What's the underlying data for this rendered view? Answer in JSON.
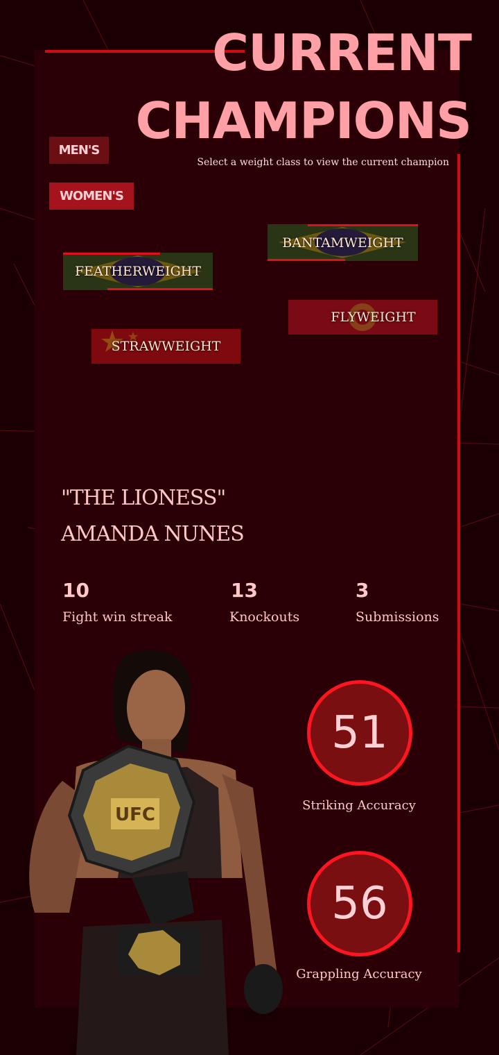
{
  "header": {
    "title_line1": "CURRENT",
    "title_line2": "CHAMPIONS",
    "subtitle": "Select a weight class to view the current champion"
  },
  "categories": [
    {
      "label": "MEN'S"
    },
    {
      "label": "WOMEN'S"
    }
  ],
  "weight_classes": [
    {
      "label": "BANTAMWEIGHT",
      "flag": "brazil-flag"
    },
    {
      "label": "FEATHERWEIGHT",
      "flag": "brazil-flag"
    },
    {
      "label": "FLYWEIGHT",
      "flag": "kyrgyzstan-flag"
    },
    {
      "label": "STRAWWEIGHT",
      "flag": "china-flag"
    }
  ],
  "champion": {
    "nickname": "\"THE LIONESS\"",
    "name": "AMANDA NUNES",
    "stats": [
      {
        "value": "10",
        "label": "Fight win streak"
      },
      {
        "value": "13",
        "label": "Knockouts"
      },
      {
        "value": "3",
        "label": "Submissions"
      }
    ],
    "accuracy": [
      {
        "value": "51",
        "label": "Striking Accuracy"
      },
      {
        "value": "56",
        "label": "Grappling Accuracy"
      }
    ]
  },
  "colors": {
    "background": "#1a0003",
    "panel": "#2a0006",
    "accent": "#d10a16",
    "title": "#ffa0a6",
    "text": "#ffc8c8"
  }
}
